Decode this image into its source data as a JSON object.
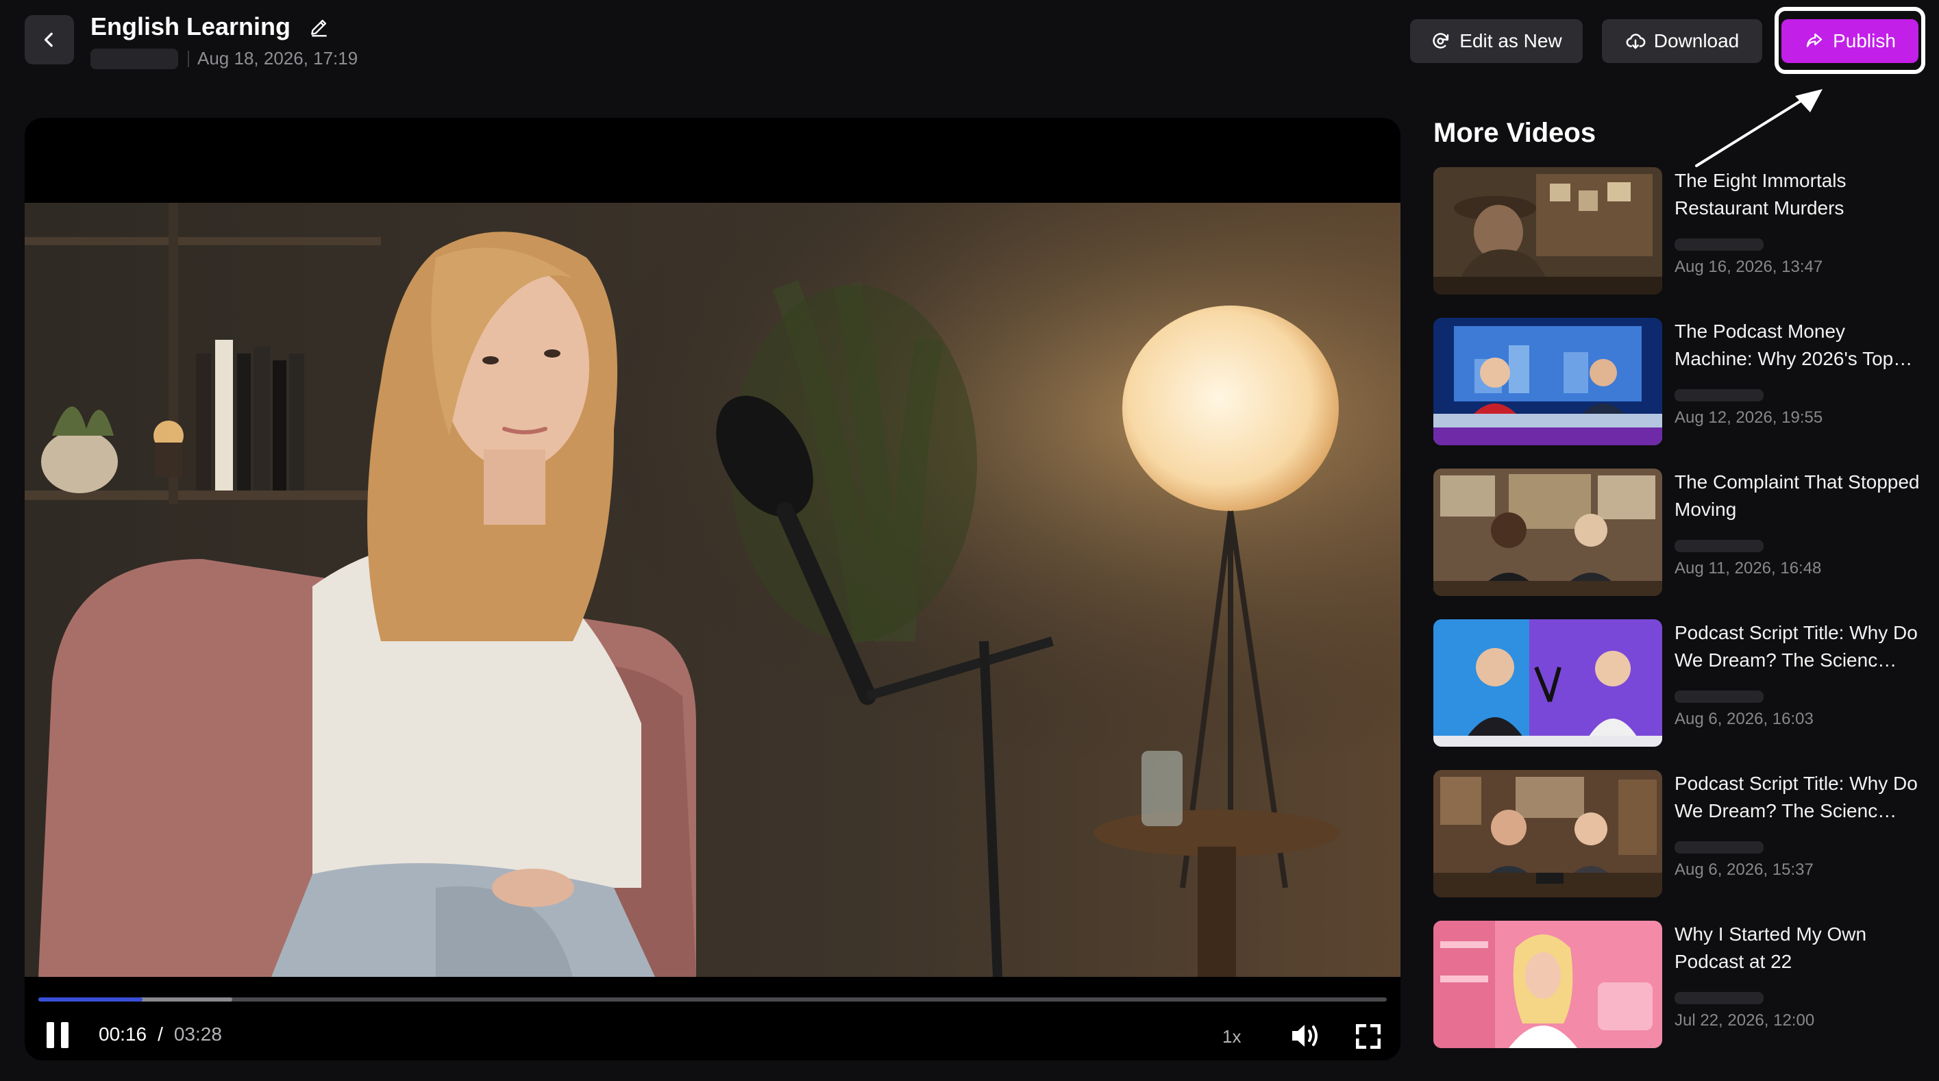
{
  "header": {
    "title": "English Learning",
    "date": "Aug 18, 2026, 17:19",
    "buttons": {
      "edit_as_new": "Edit as New",
      "download": "Download",
      "publish": "Publish"
    }
  },
  "player": {
    "current_time": "00:16",
    "separator": "/",
    "duration": "03:28",
    "speed": "1x",
    "progress_fraction": 0.077,
    "buffered_fraction": 0.144
  },
  "sidebar": {
    "title": "More Videos",
    "videos": [
      {
        "title": "The Eight Immortals Restaurant Murders",
        "date": "Aug 16, 2026, 13:47"
      },
      {
        "title": "The Podcast Money Machine: Why 2026's Top…",
        "date": "Aug 12, 2026, 19:55"
      },
      {
        "title": "The Complaint That Stopped Moving",
        "date": "Aug 11, 2026, 16:48"
      },
      {
        "title": "Podcast Script Title: Why Do We Dream? The Scienc…",
        "date": "Aug 6, 2026, 16:03"
      },
      {
        "title": "Podcast Script Title: Why Do We Dream? The Scienc…",
        "date": "Aug 6, 2026, 15:37"
      },
      {
        "title": "Why I Started My Own Podcast at 22",
        "date": "Jul 22, 2026, 12:00"
      }
    ]
  },
  "colors": {
    "accent_publish": "#c21fe8",
    "progress": "#3a4fd8",
    "background": "#0e0e10"
  }
}
